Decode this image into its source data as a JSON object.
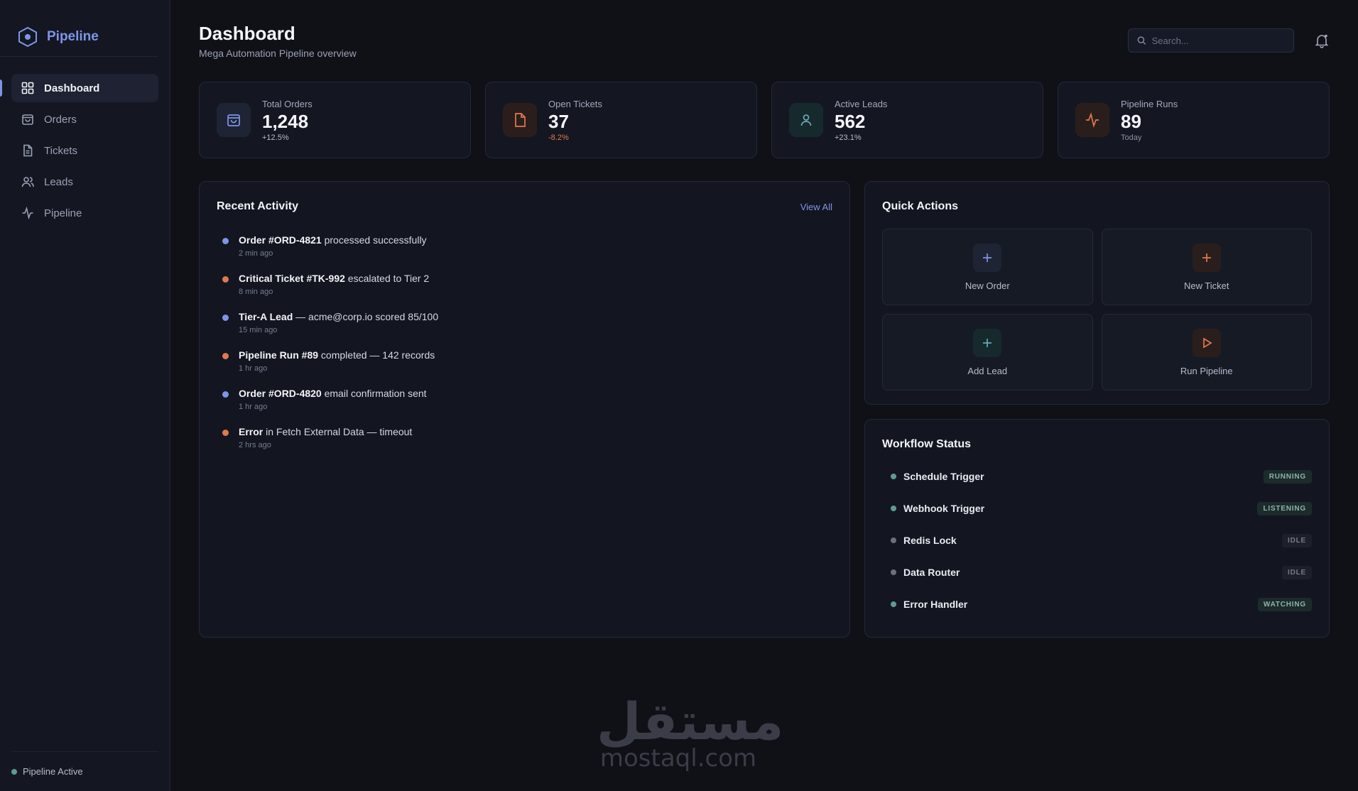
{
  "brand": {
    "name": "Pipeline"
  },
  "nav": [
    {
      "label": "Dashboard",
      "icon": "grid-icon"
    },
    {
      "label": "Orders",
      "icon": "shopping-bag-icon"
    },
    {
      "label": "Tickets",
      "icon": "file-icon"
    },
    {
      "label": "Leads",
      "icon": "users-icon"
    },
    {
      "label": "Pipeline",
      "icon": "activity-icon"
    }
  ],
  "footer": {
    "status": "Pipeline Active"
  },
  "header": {
    "title": "Dashboard",
    "subtitle": "Mega Automation Pipeline overview",
    "search_placeholder": "Search..."
  },
  "stats": [
    {
      "label": "Total Orders",
      "value": "1,248",
      "change": "+12.5%",
      "color": "#7f94e8",
      "icon": "shopping-bag-icon"
    },
    {
      "label": "Open Tickets",
      "value": "37",
      "change": "-8.2%",
      "color": "#e0794d",
      "icon": "file-icon"
    },
    {
      "label": "Active Leads",
      "value": "562",
      "change": "+23.1%",
      "color": "#6aa6b8",
      "icon": "user-icon"
    },
    {
      "label": "Pipeline Runs",
      "value": "89",
      "change": "Today",
      "color": "#e0794d",
      "icon": "activity-icon"
    }
  ],
  "activity": {
    "title": "Recent Activity",
    "view_all": "View All",
    "items": [
      {
        "bold": "Order #ORD-4821",
        "rest": " processed successfully",
        "time": "2 min ago",
        "color": "#7f94e8"
      },
      {
        "bold": "Critical Ticket #TK-992",
        "rest": " escalated to Tier 2",
        "time": "8 min ago",
        "color": "#e0794d"
      },
      {
        "bold": "Tier-A Lead",
        "rest": " — acme@corp.io scored 85/100",
        "time": "15 min ago",
        "color": "#7f94e8"
      },
      {
        "bold": "Pipeline Run #89",
        "rest": " completed — 142 records",
        "time": "1 hr ago",
        "color": "#e0794d"
      },
      {
        "bold": "Order #ORD-4820",
        "rest": " email confirmation sent",
        "time": "1 hr ago",
        "color": "#7f94e8"
      },
      {
        "bold": "Error",
        "rest": " in Fetch External Data — timeout",
        "time": "2 hrs ago",
        "color": "#e0794d"
      }
    ]
  },
  "quick_actions": {
    "title": "Quick Actions",
    "items": [
      {
        "label": "New Order",
        "icon": "plus-icon",
        "color": "#7f94e8",
        "bg": "#1f2435"
      },
      {
        "label": "New Ticket",
        "icon": "plus-icon",
        "color": "#e0794d",
        "bg": "#2a1e1c"
      },
      {
        "label": "Add Lead",
        "icon": "plus-icon",
        "color": "#6aa6b8",
        "bg": "#16292d"
      },
      {
        "label": "Run Pipeline",
        "icon": "play-icon",
        "color": "#e0794d",
        "bg": "#2a1e1c"
      }
    ]
  },
  "workflow": {
    "title": "Workflow Status",
    "items": [
      {
        "name": "Schedule Trigger",
        "status": "RUNNING",
        "active": true
      },
      {
        "name": "Webhook Trigger",
        "status": "LISTENING",
        "active": true
      },
      {
        "name": "Redis Lock",
        "status": "IDLE",
        "active": false
      },
      {
        "name": "Data Router",
        "status": "IDLE",
        "active": false
      },
      {
        "name": "Error Handler",
        "status": "WATCHING",
        "active": true
      }
    ]
  },
  "watermark": {
    "arabic": "مستقل",
    "latin": "mostaql.com"
  }
}
